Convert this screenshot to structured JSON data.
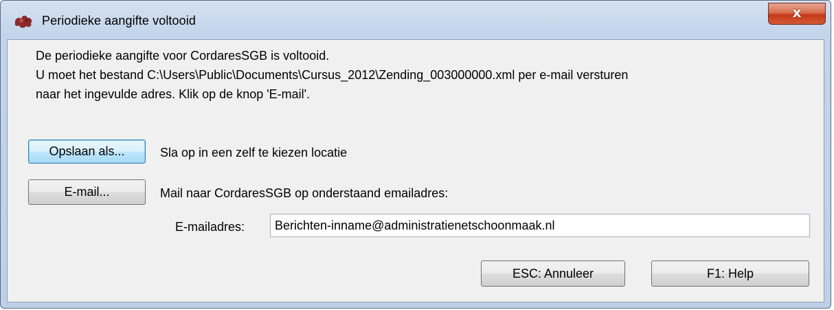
{
  "window": {
    "title": "Periodieke aangifte voltooid",
    "close_glyph": "x",
    "app_icon": "cordares-logo-icon"
  },
  "message": {
    "line1": "De periodieke aangifte voor CordaresSGB is voltooid.",
    "line2": "U moet het bestand C:\\Users\\Public\\Documents\\Cursus_2012\\Zending_003000000.xml per e-mail versturen",
    "line3": "naar het ingevulde adres. Klik op de knop 'E-mail'."
  },
  "save": {
    "button_label": "Opslaan als...",
    "description": "Sla op in een zelf te kiezen locatie"
  },
  "email": {
    "button_label": "E-mail...",
    "description": "Mail naar CordaresSGB op onderstaand emailadres:",
    "field_label": "E-mailadres:",
    "field_value": "Berichten-inname@administratienetschoonmaak.nl"
  },
  "footer": {
    "cancel_label": "ESC: Annuleer",
    "help_label": "F1: Help"
  },
  "colors": {
    "titlebar": "#c3d4ea",
    "client": "#f0f0f0",
    "close_button": "#c4391a",
    "default_button_border": "#3c7fb1"
  }
}
